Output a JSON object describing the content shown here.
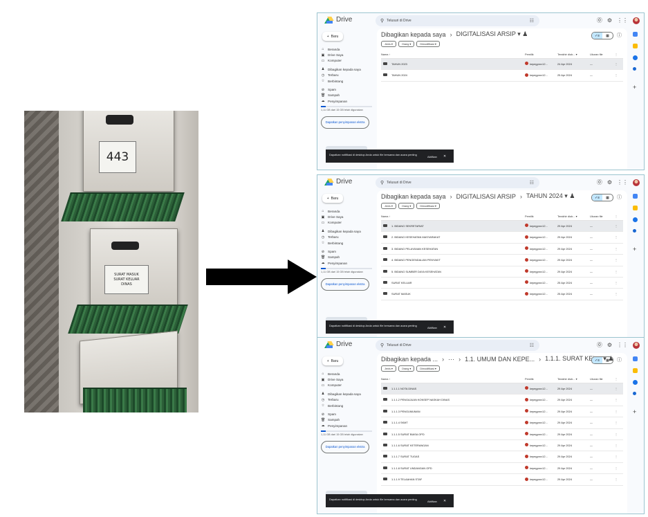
{
  "photo": {
    "cabinet_label_top": "443",
    "cabinet_label_middle": "SURAT MASUK\nSURAT KELUAR\nDINAS"
  },
  "app": {
    "name": "Drive",
    "search_placeholder": "Telusuri di Drive",
    "new_label": "Baru",
    "nav": [
      {
        "icon": "home-icon",
        "glyph": "⌂",
        "label": "Beranda"
      },
      {
        "icon": "drive-icon",
        "glyph": "▣",
        "label": "Drive Saya"
      },
      {
        "icon": "computer-icon",
        "glyph": "▭",
        "label": "Komputer"
      },
      {
        "icon": "shared-icon",
        "glyph": "♟",
        "label": "Dibagikan kepada saya"
      },
      {
        "icon": "clock-icon",
        "glyph": "◷",
        "label": "Terbaru"
      },
      {
        "icon": "star-icon",
        "glyph": "☆",
        "label": "Berbintang"
      },
      {
        "icon": "spam-icon",
        "glyph": "⊘",
        "label": "Spam"
      },
      {
        "icon": "trash-icon",
        "glyph": "🗑",
        "label": "Sampah"
      },
      {
        "icon": "cloud-icon",
        "glyph": "☁",
        "label": "Penyimpanan"
      }
    ],
    "storage_text": "1,11 GB dari 15 GB telah digunakan",
    "extra_storage": "Dapatkan penyimpanan ekstra",
    "filters": [
      "Jenis ▾",
      "Orang ▾",
      "Dimodifikasi ▾"
    ],
    "columns": {
      "name": "Nama ↑",
      "owner": "Pemilik",
      "modified": "Terakhir diub... ▾",
      "size": "Ukuran file"
    },
    "toast": {
      "message": "Dapatkan notifikasi di desktop Anda untuk file bersama dan acara penting",
      "action": "Aktifkan"
    },
    "colors": {
      "accent": "#0b57d0",
      "selected_view": "#c2e7ff",
      "panel_bg": "#f8fafd"
    }
  },
  "panels": [
    {
      "breadcrumb": [
        "Dibagikan kepada saya",
        "DIGITALISASI ARSIP ▾ ♟"
      ],
      "rows": [
        {
          "name": "TAHUN 2023",
          "owner": "kepegprov12...",
          "modified": "24 Apr 2024",
          "size": "—",
          "selected": true
        },
        {
          "name": "TAHUN 2024",
          "owner": "kepegprov12...",
          "modified": "25 Apr 2024",
          "size": "—",
          "selected": false
        }
      ]
    },
    {
      "breadcrumb": [
        "Dibagikan kepada saya",
        "DIGITALISASI ARSIP",
        "TAHUN 2024 ▾ ♟"
      ],
      "rows": [
        {
          "name": "1. BIDANG SEKRETARIAT",
          "owner": "kepegprov12...",
          "modified": "29 Apr 2024",
          "size": "—",
          "selected": true
        },
        {
          "name": "2. BIDANG KESEHATAN MASYARAKAT",
          "owner": "kepegprov12...",
          "modified": "29 Apr 2024",
          "size": "—",
          "selected": false
        },
        {
          "name": "3. BIDANG PELAYANAN KESEHATAN",
          "owner": "kepegprov12...",
          "modified": "29 Apr 2024",
          "size": "—",
          "selected": false
        },
        {
          "name": "4. BIDANG PENGENDALIAN PENYAKIT",
          "owner": "kepegprov12...",
          "modified": "29 Apr 2024",
          "size": "—",
          "selected": false
        },
        {
          "name": "5. BIDANG SUMBER DAYA KESEHATAN",
          "owner": "kepegprov12...",
          "modified": "29 Apr 2024",
          "size": "—",
          "selected": false
        },
        {
          "name": "SURAT KELUAR",
          "owner": "kepegprov12...",
          "modified": "25 Apr 2024",
          "size": "—",
          "selected": false
        },
        {
          "name": "SURAT MASUK",
          "owner": "kepegprov12...",
          "modified": "25 Apr 2024",
          "size": "—",
          "selected": false
        }
      ]
    },
    {
      "breadcrumb": [
        "Dibagikan kepada ...",
        "···",
        "1.1. UMUM DAN KEPE...",
        "1.1.1. SURAT KEL... ▾ ♟"
      ],
      "rows": [
        {
          "name": "1.1.1.1 NOTA DINAS",
          "owner": "kepegprov12...",
          "modified": "29 Apr 2024",
          "size": "—",
          "selected": true
        },
        {
          "name": "1.1.1.2 PENGAJUAN KONSEP NASKAH DINAS",
          "owner": "kepegprov12...",
          "modified": "29 Apr 2024",
          "size": "—",
          "selected": false
        },
        {
          "name": "1.1.1.3 PENGUMUMAN",
          "owner": "kepegprov12...",
          "modified": "29 Apr 2024",
          "size": "—",
          "selected": false
        },
        {
          "name": "1.1.1.4 SKMT",
          "owner": "kepegprov12...",
          "modified": "29 Apr 2024",
          "size": "—",
          "selected": false
        },
        {
          "name": "1.1.1.5 SURAT BIASA OPD",
          "owner": "kepegprov12...",
          "modified": "29 Apr 2024",
          "size": "—",
          "selected": false
        },
        {
          "name": "1.1.1.6 SURAT KETERANGAN",
          "owner": "kepegprov12...",
          "modified": "29 Apr 2024",
          "size": "—",
          "selected": false
        },
        {
          "name": "1.1.1.7 SURAT TUGAS",
          "owner": "kepegprov12...",
          "modified": "29 Apr 2024",
          "size": "—",
          "selected": false
        },
        {
          "name": "1.1.1.8 SURAT UNDANGAN OPD",
          "owner": "kepegprov12...",
          "modified": "29 Apr 2024",
          "size": "—",
          "selected": false
        },
        {
          "name": "1.1.1.9 TELAAHAN STAF",
          "owner": "kepegprov12...",
          "modified": "29 Apr 2024",
          "size": "—",
          "selected": false
        }
      ]
    }
  ]
}
